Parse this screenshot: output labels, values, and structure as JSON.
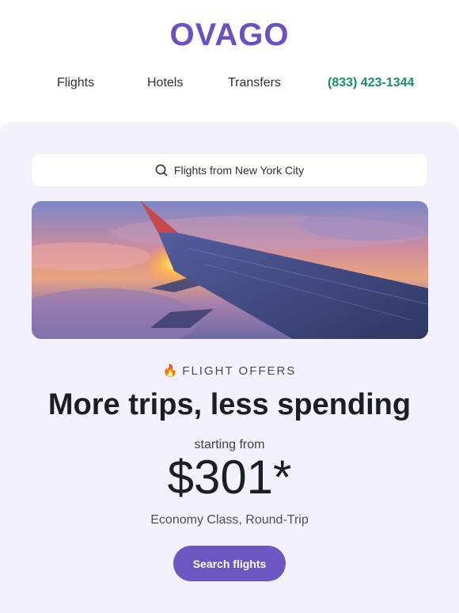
{
  "brand": {
    "logo_text": "OVAGO",
    "accent": "#6b4fc4"
  },
  "nav": {
    "items": [
      {
        "label": "Flights"
      },
      {
        "label": "Hotels"
      },
      {
        "label": "Transfers"
      }
    ],
    "phone": "(833) 423-1344",
    "phone_color": "#1a8f63"
  },
  "search": {
    "placeholder": "Flights from New York City",
    "icon": "search-icon"
  },
  "hero": {
    "image": "airplane-wing-sunset"
  },
  "offer": {
    "eyebrow_icon": "fire-icon",
    "eyebrow": "FLIGHT OFFERS",
    "headline": "More trips, less spending",
    "starting_label": "starting from",
    "price": "$301*",
    "fare_note": "Economy Class, Round-Trip",
    "cta_label": "Search flights",
    "cta_color": "#6c56c2"
  },
  "panel_bg": "#f3f2fc"
}
